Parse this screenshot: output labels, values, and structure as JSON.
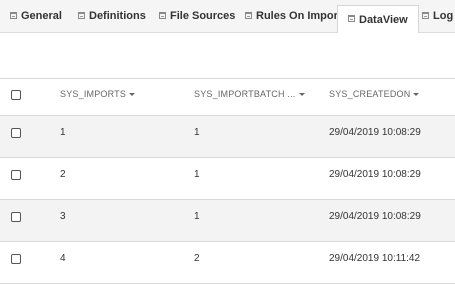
{
  "tabs": [
    {
      "label": "General",
      "icon": "list-icon"
    },
    {
      "label": "Definitions",
      "icon": "list-icon"
    },
    {
      "label": "File Sources",
      "icon": "list-icon"
    },
    {
      "label": "Rules On Import",
      "icon": "list-icon"
    },
    {
      "label": "DataView",
      "icon": "list-icon",
      "active": true
    },
    {
      "label": "Log",
      "icon": "list-icon"
    }
  ],
  "table": {
    "columns": [
      "SYS_IMPORTS",
      "SYS_IMPORTBATCH ...",
      "SYS_CREATEDON"
    ],
    "rows": [
      [
        "1",
        "1",
        "29/04/2019 10:08:29"
      ],
      [
        "2",
        "1",
        "29/04/2019 10:08:29"
      ],
      [
        "3",
        "1",
        "29/04/2019 10:08:29"
      ],
      [
        "4",
        "2",
        "29/04/2019 10:11:42"
      ]
    ]
  }
}
